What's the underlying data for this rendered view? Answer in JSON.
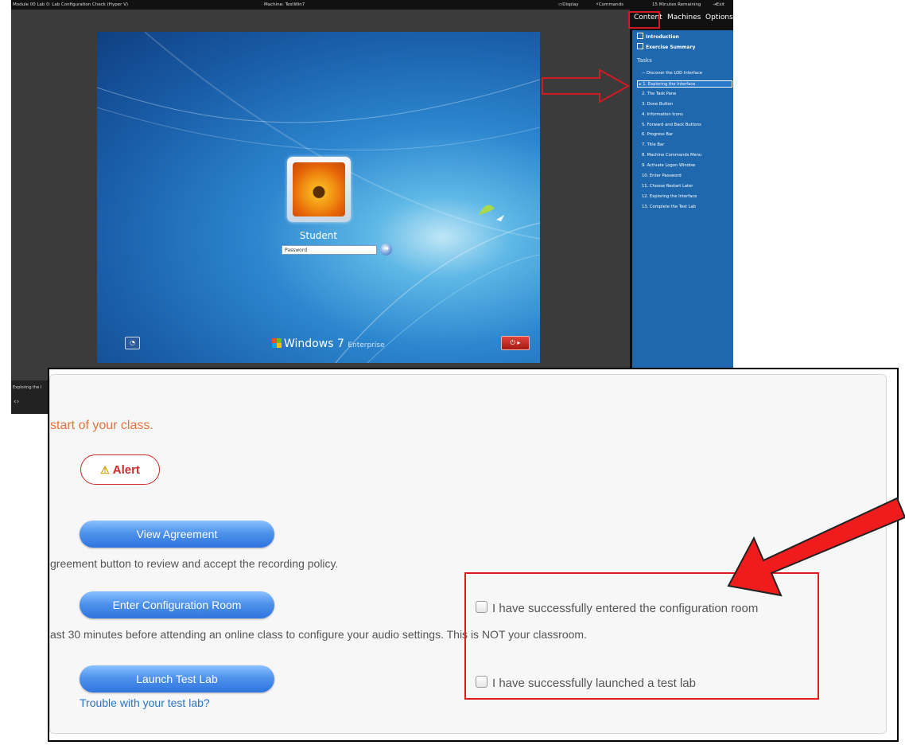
{
  "lab_window": {
    "title": "Module 00 Lab 0: Lab Configuration Check (Hyper V)",
    "machine": "Machine: TestWin7",
    "display": "Display",
    "commands": "Commands",
    "time_remaining": "15 Minutes Remaining",
    "exit": "Exit",
    "vm": {
      "user_name": "Student",
      "password_placeholder": "Password",
      "brand": "Windows 7",
      "edition": "Enterprise"
    },
    "footer_label": "Exploring the I"
  },
  "side_panel": {
    "tabs": [
      "Content",
      "Machines",
      "Options"
    ],
    "links": [
      "Introduction",
      "Exercise Summary"
    ],
    "tasks_label": "Tasks",
    "tasks": [
      "− Discover the LOD Interface",
      "▸ 1. Exploring the Interface",
      "2. The Task Pane",
      "3. Done Button",
      "4. Information Icons",
      "5. Forward and Back Buttons",
      "6. Progress Bar",
      "7. Title Bar",
      "8. Machine Commands Menu",
      "9. Activate Logon Window",
      "10. Enter Password",
      "11. Choose Restart Later",
      "12. Exploring the Interface",
      "13. Complete the Test Lab"
    ],
    "active_task_index": 1
  },
  "overlay": {
    "intro": "start of your class.",
    "alert_label": "Alert",
    "view_agreement_button": "View Agreement",
    "agreement_desc": "greement button to review and accept the recording policy.",
    "config_room_button": "Enter Configuration Room",
    "config_desc": "ast 30 minutes before attending an online class to configure your audio settings. This is NOT your classroom.",
    "launch_button": "Launch Test Lab",
    "trouble_link": "Trouble with your test lab?",
    "check_config": "I have successfully entered the configuration room",
    "check_lab": "I have successfully launched a test lab",
    "check_config_checked": false,
    "check_lab_checked": false
  },
  "colors": {
    "highlight_red": "#e01b1b",
    "panel_blue": "#1f68ad",
    "button_blue": "#4f93ec",
    "intro_orange": "#e8723a",
    "link_blue": "#2a74c4"
  }
}
